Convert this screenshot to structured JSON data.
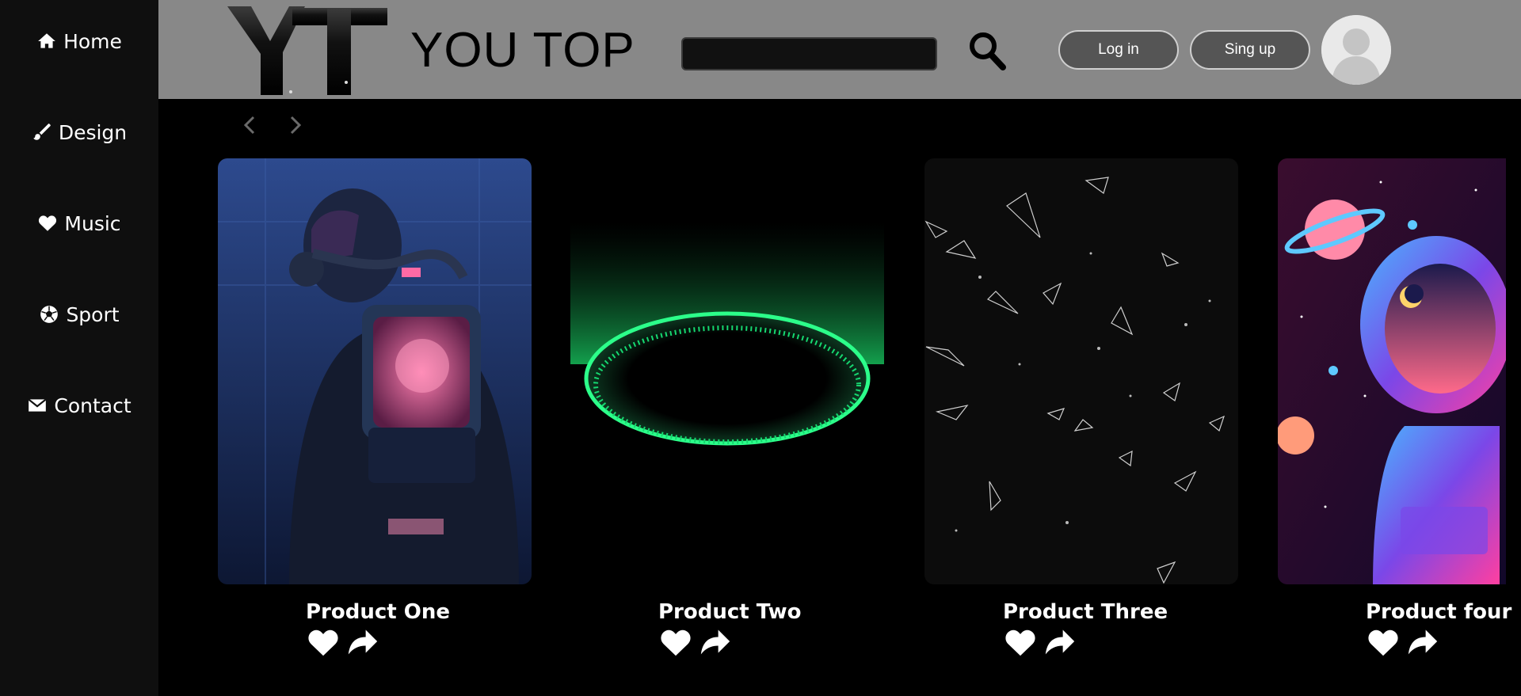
{
  "sidebar": {
    "items": [
      {
        "label": "Home",
        "icon": "home-icon"
      },
      {
        "label": "Design",
        "icon": "brush-icon"
      },
      {
        "label": "Music",
        "icon": "heart-icon"
      },
      {
        "label": "Sport",
        "icon": "soccer-ball-icon"
      },
      {
        "label": "Contact",
        "icon": "envelope-icon"
      }
    ]
  },
  "header": {
    "logo_text": "YT",
    "brand": "YOU TOP",
    "search": {
      "value": "",
      "placeholder": ""
    },
    "login_label": "Log in",
    "signup_label": "Sing up"
  },
  "carousel": {
    "prev_icon": "chevron-left-icon",
    "next_icon": "chevron-right-icon"
  },
  "products": [
    {
      "title": "Product One"
    },
    {
      "title": "Product Two"
    },
    {
      "title": "Product Three"
    },
    {
      "title": "Product four"
    }
  ],
  "colors": {
    "sidebar_bg": "#0f0f0f",
    "header_bg": "#888888",
    "page_bg": "#000000",
    "pill_bg": "#555555",
    "accent_green": "#2cff8a"
  }
}
